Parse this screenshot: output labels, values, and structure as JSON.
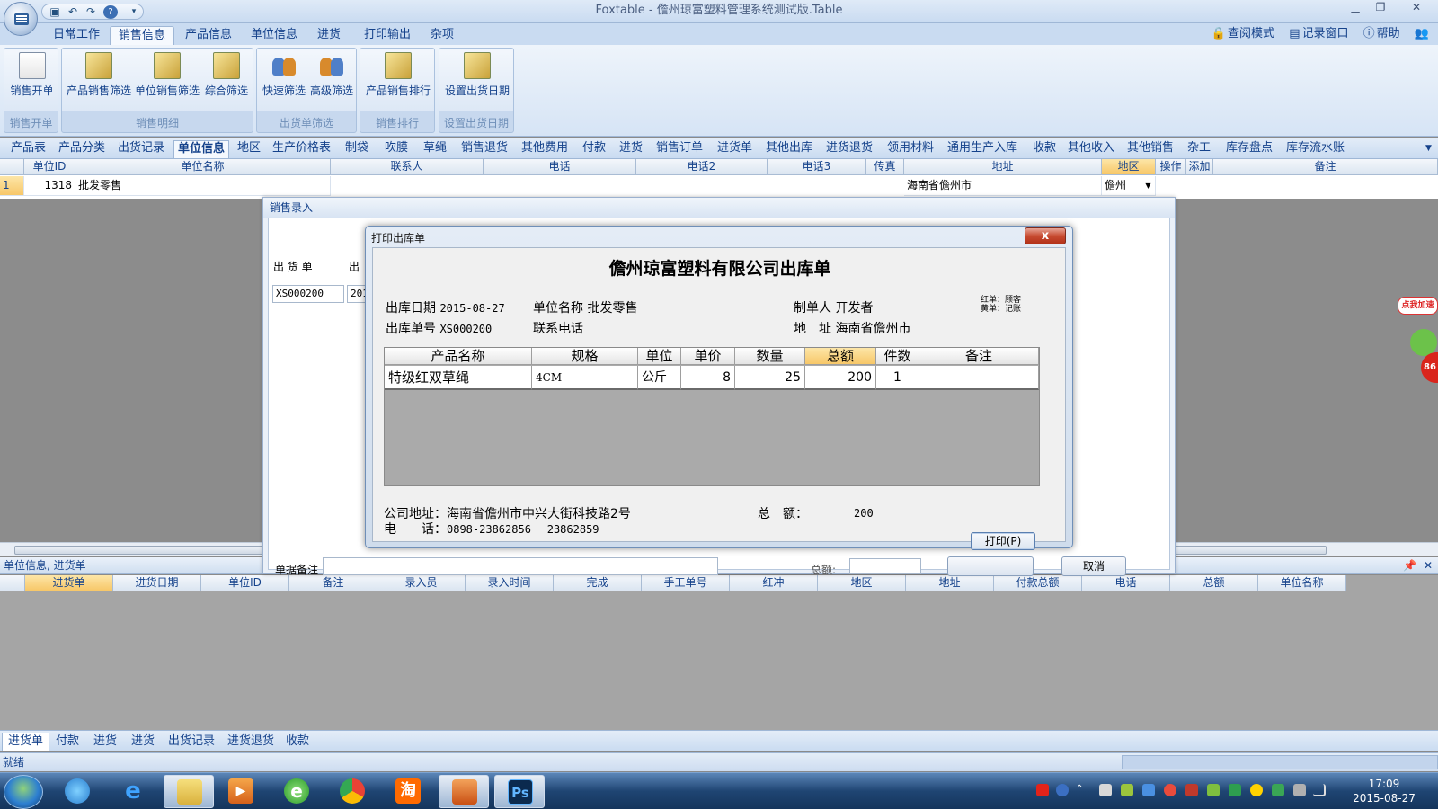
{
  "window": {
    "title": "Foxtable - 儋州琼富塑料管理系统测试版.Table"
  },
  "ribbon_tabs": [
    "日常工作",
    "销售信息",
    "产品信息",
    "单位信息",
    "进货",
    "打印输出",
    "杂项"
  ],
  "right_menu": [
    "查阅模式",
    "记录窗口",
    "帮助"
  ],
  "ribbon": {
    "groups": [
      {
        "label": "销售开单",
        "buttons": [
          "销售开单"
        ]
      },
      {
        "label": "销售明细",
        "buttons": [
          "产品销售筛选",
          "单位销售筛选",
          "综合筛选"
        ]
      },
      {
        "label": "出货单筛选",
        "buttons": [
          "快速筛选",
          "高级筛选"
        ]
      },
      {
        "label": "销售排行",
        "buttons": [
          "产品销售排行"
        ]
      },
      {
        "label": "设置出货日期",
        "buttons": [
          "设置出货日期"
        ]
      }
    ]
  },
  "object_tabs": [
    "产品表",
    "产品分类",
    "出货记录",
    "单位信息",
    "地区",
    "生产价格表",
    "制袋",
    "吹膜",
    "草绳",
    "销售退货",
    "其他费用",
    "付款",
    "进货",
    "销售订单",
    "进货单",
    "其他出库",
    "进货退货",
    "领用材料",
    "通用生产入库",
    "收款",
    "其他收入",
    "其他销售",
    "杂工",
    "库存盘点",
    "库存流水账"
  ],
  "grid1": {
    "headers": [
      "单位ID",
      "单位名称",
      "联系人",
      "电话",
      "电话2",
      "电话3",
      "传真",
      "地址",
      "地区",
      "操作",
      "添加",
      "备注"
    ],
    "row": {
      "num": "1",
      "id": "1318",
      "name": "批发零售",
      "address": "海南省儋州市",
      "region": "儋州"
    }
  },
  "bottom_panel": {
    "title": "单位信息, 进货单",
    "headers": [
      "进货单",
      "进货日期",
      "单位ID",
      "备注",
      "录入员",
      "录入时间",
      "完成",
      "手工单号",
      "红冲",
      "地区",
      "地址",
      "付款总额",
      "电话",
      "总额",
      "单位名称"
    ]
  },
  "bottom_tabs": [
    "进货单",
    "付款",
    "进货",
    "进货",
    "出货记录",
    "进货退货",
    "收款"
  ],
  "status": "就绪",
  "sales_dialog": {
    "title": "销售录入",
    "label_order": "出 货 单",
    "label_col2": "出",
    "order_value": "XS000200",
    "col2_value": "201",
    "label_note": "单据备注",
    "label_total": "总额:",
    "cancel": "取消"
  },
  "print_dialog": {
    "title": "打印出库单",
    "close": "x",
    "heading": "儋州琼富塑料有限公司出库单",
    "date_label": "出库日期",
    "date_value": "2015-08-27",
    "unit_label": "单位名称",
    "unit_value": "批发零售",
    "maker_label": "制单人",
    "maker_value": "开发者",
    "side1": "红单：顾客",
    "side2": "黄单：记账",
    "no_label": "出库单号",
    "no_value": "XS000200",
    "phone_label": "联系电话",
    "addr_label": "地　址",
    "addr_value": "海南省儋州市",
    "table_headers": [
      "产品名称",
      "规格",
      "单位",
      "单价",
      "数量",
      "总额",
      "件数",
      "备注"
    ],
    "row": {
      "product": "特级红双草绳",
      "spec": "4CM",
      "unit": "公斤",
      "price": "8",
      "qty": "25",
      "total": "200",
      "pieces": "1",
      "note": ""
    },
    "company_addr": "公司地址：海南省儋州市中兴大街科技路2号",
    "company_phone_label": "电　　话：",
    "company_phone1": "0898-23862856",
    "company_phone2": "23862859",
    "total_label": "总　额：",
    "total_value": "200",
    "print_btn": "打印(P)"
  },
  "taskbar": {
    "time": "17:09",
    "date": "2015-08-27",
    "taobao": "淘",
    "ps": "Ps"
  },
  "ad": {
    "text": "点我加速",
    "num": "86"
  }
}
